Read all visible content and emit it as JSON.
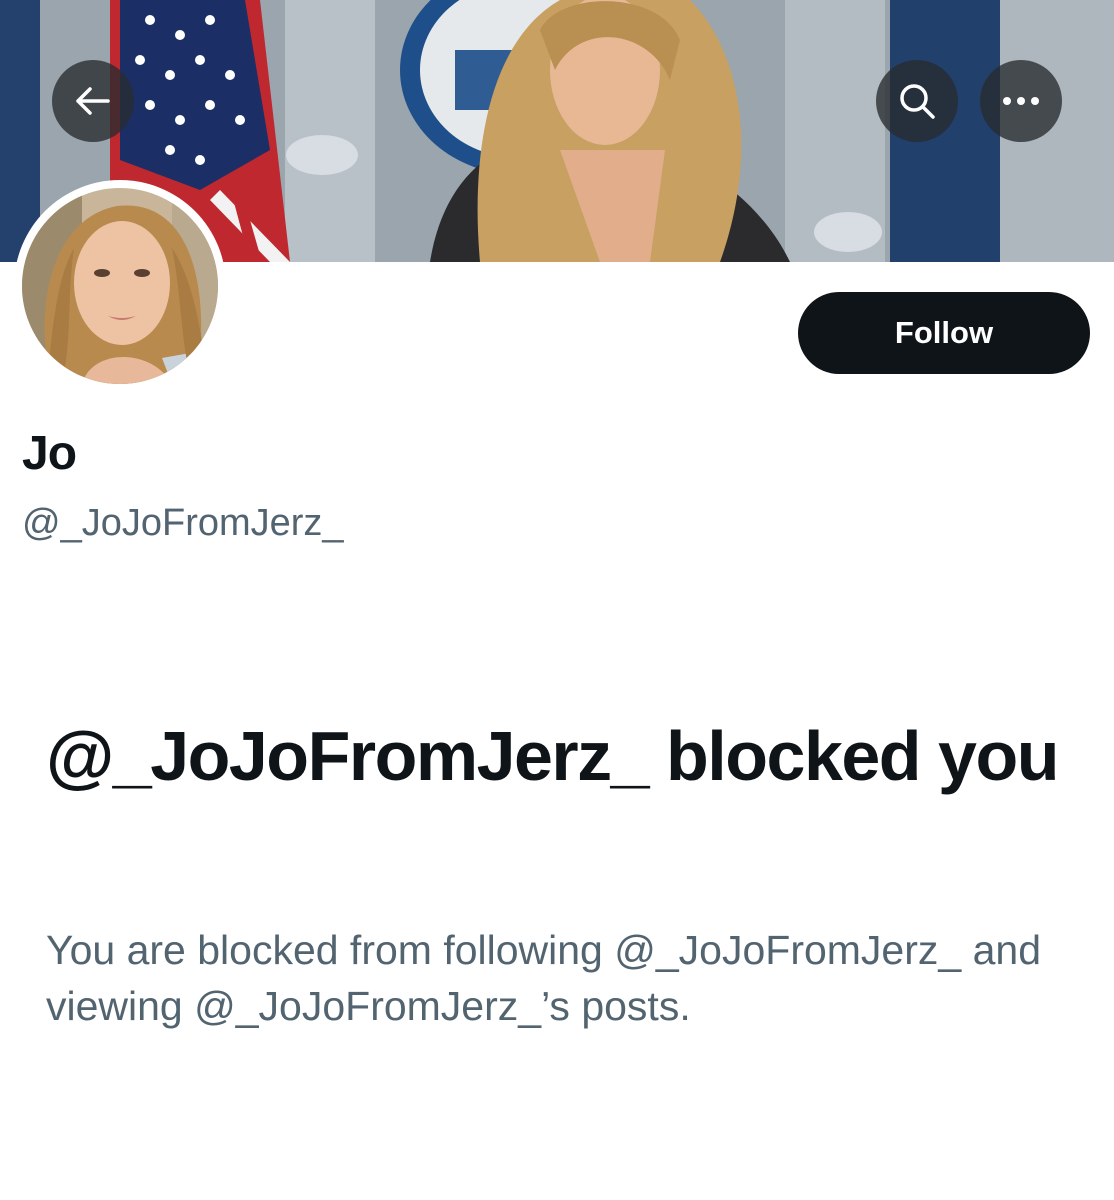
{
  "header": {
    "back_icon": "arrow-left-icon",
    "search_icon": "search-icon",
    "more_icon": "more-horizontal-icon"
  },
  "profile": {
    "display_name": "Jo",
    "handle": "@_JoJoFromJerz_",
    "follow_label": "Follow"
  },
  "blocked_notice": {
    "title": "@_JoJoFromJerz_ blocked you",
    "description": "You are blocked from following @_JoJoFromJerz_ and viewing @_JoJoFromJerz_’s posts."
  },
  "colors": {
    "text_primary": "#0f1419",
    "text_secondary": "#536471",
    "button_bg": "#0f1419",
    "button_text": "#ffffff",
    "background": "#ffffff"
  }
}
